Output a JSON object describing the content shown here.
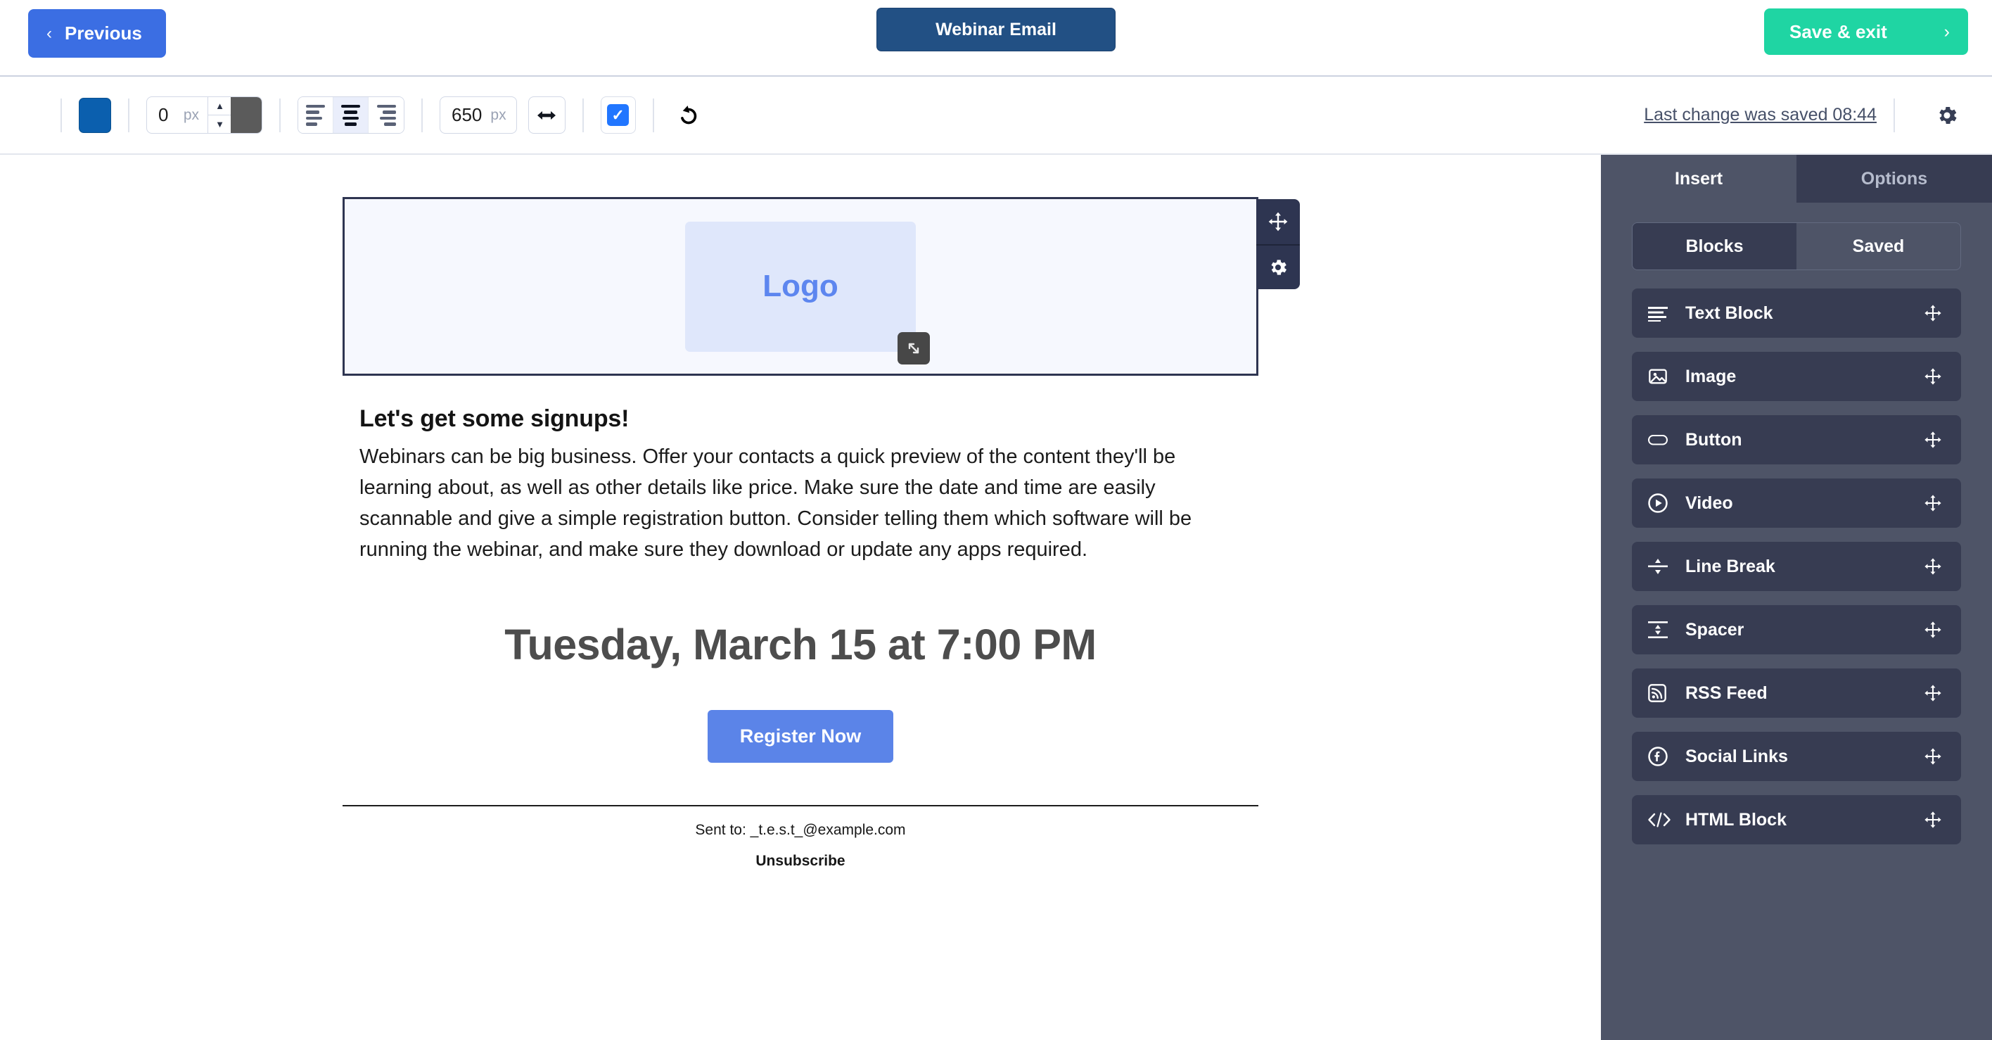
{
  "header": {
    "previous_label": "Previous",
    "previous_chevron": "‹",
    "document_tab": "Webinar Email",
    "save_label": "Save & exit",
    "save_chevron": "›"
  },
  "toolbar": {
    "fill_color": "#0b5fae",
    "border_color": "#5b5b5b",
    "border_width_value": "0",
    "border_width_unit": "px",
    "spin_up": "▲",
    "spin_down": "▼",
    "align_options": [
      "align-left",
      "align-center",
      "align-right"
    ],
    "align_selected": "align-center",
    "block_width_value": "650",
    "block_width_unit": "px",
    "full_width_icon": "arrows-horizontal-icon",
    "checkbox_checked": true,
    "checkbox_mark": "✓",
    "undo_icon": "undo-icon",
    "saved_status": "Last change was saved 08:44",
    "settings_icon": "gear-icon"
  },
  "canvas": {
    "logo_block": {
      "label": "Logo",
      "move_icon": "move-icon",
      "settings_icon": "gear-icon",
      "resize_icon": "resize-diagonal-icon"
    },
    "heading": "Let's get some signups!",
    "paragraph": "Webinars can be big business. Offer your contacts a quick preview of the content they'll be learning about, as well as other details like price. Make sure the date and time are easily scannable and give a simple registration button. Consider telling them which software will be running the webinar, and make sure they download or update any apps required.",
    "date_heading": "Tuesday, March 15 at 7:00 PM",
    "register_button": "Register Now",
    "sent_to": "Sent to: _t.e.s.t_@example.com",
    "unsubscribe": "Unsubscribe"
  },
  "sidebar": {
    "tabs": [
      {
        "label": "Insert",
        "active": true
      },
      {
        "label": "Options",
        "active": false
      }
    ],
    "segment": [
      {
        "label": "Blocks",
        "active": true
      },
      {
        "label": "Saved",
        "active": false
      }
    ],
    "blocks": [
      {
        "label": "Text Block",
        "icon": "text-lines-icon"
      },
      {
        "label": "Image",
        "icon": "image-icon"
      },
      {
        "label": "Button",
        "icon": "button-pill-icon"
      },
      {
        "label": "Video",
        "icon": "play-circle-icon"
      },
      {
        "label": "Line Break",
        "icon": "line-break-icon"
      },
      {
        "label": "Spacer",
        "icon": "spacer-icon"
      },
      {
        "label": "RSS Feed",
        "icon": "rss-icon"
      },
      {
        "label": "Social Links",
        "icon": "facebook-circle-icon"
      },
      {
        "label": "HTML Block",
        "icon": "code-icon"
      }
    ],
    "drag_icon": "drag-move-icon"
  }
}
